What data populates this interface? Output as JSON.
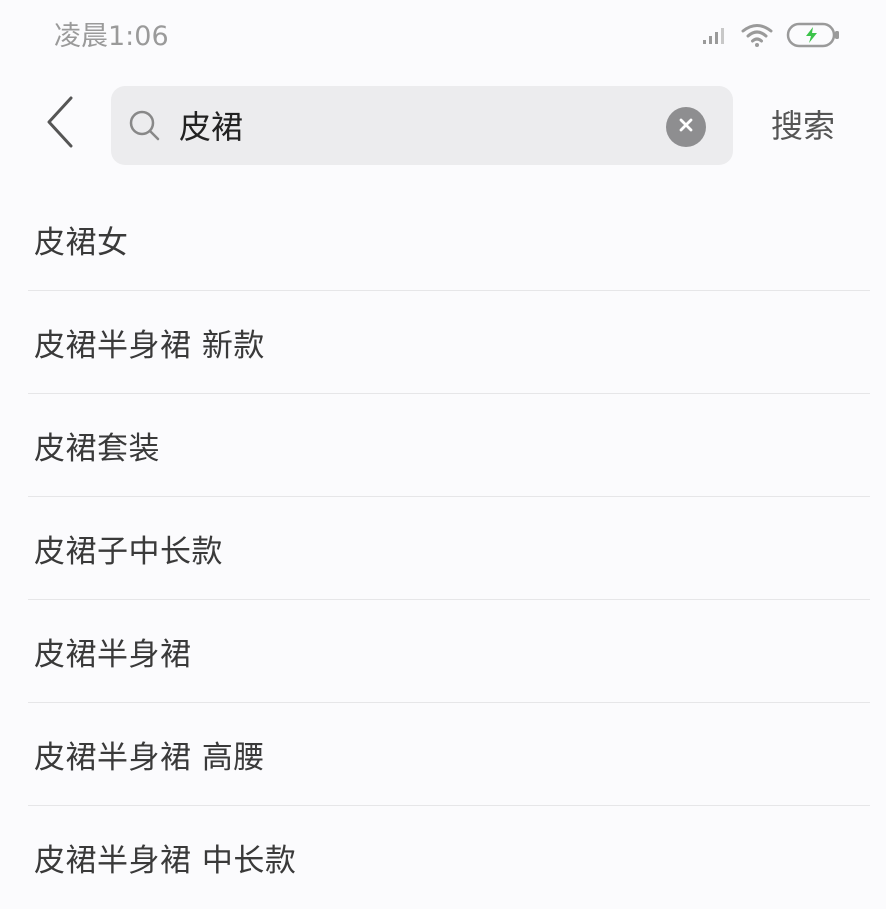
{
  "status_bar": {
    "time": "凌晨1:06",
    "icons": [
      "signal-icon",
      "wifi-icon",
      "battery-charging-icon"
    ]
  },
  "search": {
    "query": "皮裙",
    "submit_label": "搜索"
  },
  "suggestions": [
    "皮裙女",
    "皮裙半身裙 新款",
    "皮裙套装",
    "皮裙子中长款",
    "皮裙半身裙",
    "皮裙半身裙 高腰",
    "皮裙半身裙 中长款"
  ],
  "colors": {
    "background": "#fbfbfd",
    "search_box": "#ececee",
    "clear_button": "#8e8e90",
    "battery_charge": "#3cc34a"
  }
}
